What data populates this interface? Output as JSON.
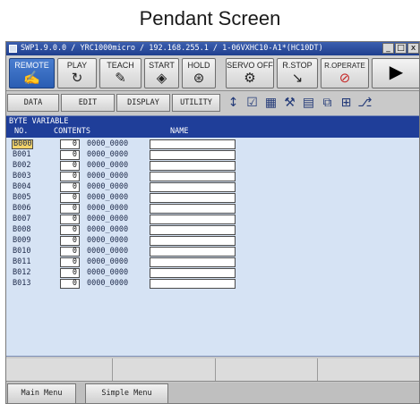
{
  "caption": "Pendant Screen",
  "window": {
    "title": "SWP1.9.0.0 / YRC1000micro / 192.168.255.1 / 1-06VXHC10-A1*(HC10DT)",
    "minimize": "_",
    "restore": "□",
    "close": "x"
  },
  "keys": {
    "remote": {
      "label": "REMOTE",
      "icon": "pendant-icon",
      "glyph": "✍"
    },
    "play": {
      "label": "PLAY",
      "icon": "play-cycle-icon",
      "glyph": "↻"
    },
    "teach": {
      "label": "TEACH",
      "icon": "teach-pendant-icon",
      "glyph": "✎"
    },
    "start": {
      "label": "START",
      "icon": "start-diamond-icon",
      "glyph": "◈"
    },
    "hold": {
      "label": "HOLD",
      "icon": "hold-circle-icon",
      "glyph": "⊛"
    },
    "servo_off": {
      "label": "SERVO OFF",
      "icon": "servo-motor-icon",
      "glyph": "⚙"
    },
    "r_stop": {
      "label": "R.STOP",
      "icon": "robot-stop-icon",
      "glyph": "↘"
    },
    "r_operate": {
      "label": "R.OPERATE",
      "icon": "prohibited-icon",
      "glyph": "⊘",
      "color": "#c62828"
    },
    "next": {
      "icon": "next-arrow-icon",
      "glyph": "▶"
    }
  },
  "menus": {
    "data": "DATA",
    "edit": "EDIT",
    "display": "DISPLAY",
    "utility": "UTILITY"
  },
  "toolbar_icons": [
    "↕",
    "☑",
    "▦",
    "⚒",
    "▤",
    "⧉",
    "⊞",
    "⎇"
  ],
  "panel": {
    "title": "BYTE VARIABLE",
    "col_no": "NO.",
    "col_contents": "CONTENTS",
    "col_name": "NAME",
    "header_color": "#1f3e99",
    "background_color": "#d6e3f4",
    "rows": [
      {
        "no": "B000",
        "value": "0",
        "bits": "0000_0000",
        "name": "",
        "selected": true
      },
      {
        "no": "B001",
        "value": "0",
        "bits": "0000_0000",
        "name": ""
      },
      {
        "no": "B002",
        "value": "0",
        "bits": "0000_0000",
        "name": ""
      },
      {
        "no": "B003",
        "value": "0",
        "bits": "0000_0000",
        "name": ""
      },
      {
        "no": "B004",
        "value": "0",
        "bits": "0000_0000",
        "name": ""
      },
      {
        "no": "B005",
        "value": "0",
        "bits": "0000_0000",
        "name": ""
      },
      {
        "no": "B006",
        "value": "0",
        "bits": "0000_0000",
        "name": ""
      },
      {
        "no": "B007",
        "value": "0",
        "bits": "0000_0000",
        "name": ""
      },
      {
        "no": "B008",
        "value": "0",
        "bits": "0000_0000",
        "name": ""
      },
      {
        "no": "B009",
        "value": "0",
        "bits": "0000_0000",
        "name": ""
      },
      {
        "no": "B010",
        "value": "0",
        "bits": "0000_0000",
        "name": ""
      },
      {
        "no": "B011",
        "value": "0",
        "bits": "0000_0000",
        "name": ""
      },
      {
        "no": "B012",
        "value": "0",
        "bits": "0000_0000",
        "name": ""
      },
      {
        "no": "B013",
        "value": "0",
        "bits": "0000_0000",
        "name": ""
      }
    ]
  },
  "bottom": {
    "main_menu": "Main Menu",
    "simple_menu": "Simple Menu"
  }
}
